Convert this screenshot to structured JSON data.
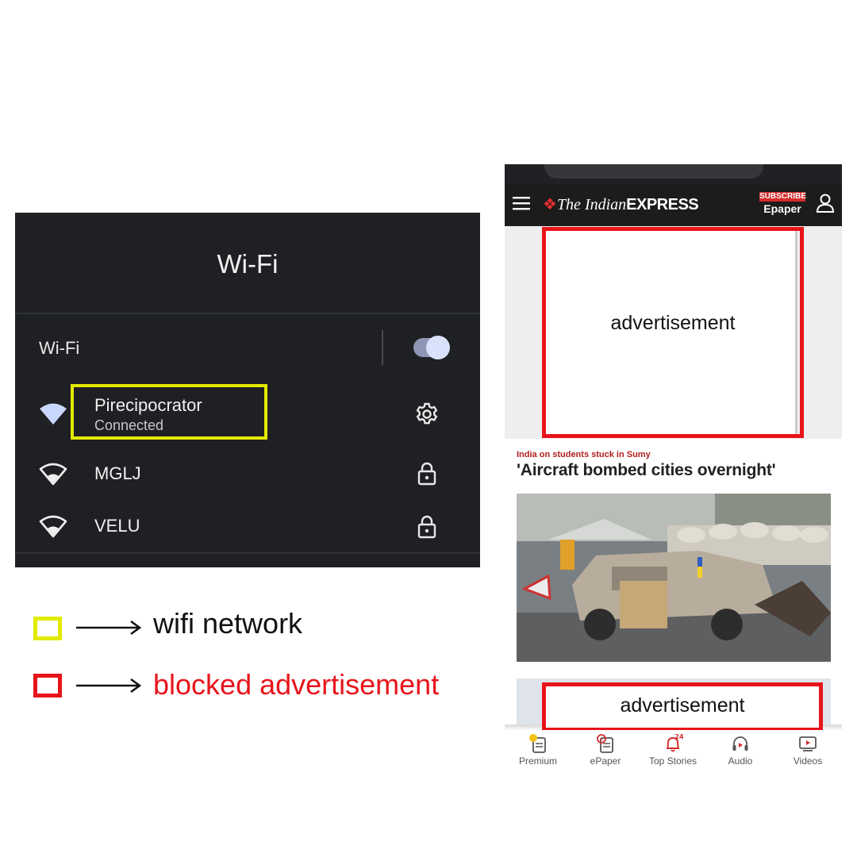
{
  "wifi_panel": {
    "title": "Wi-Fi",
    "toggle_label": "Wi-Fi",
    "toggle_on": true,
    "networks": [
      {
        "name": "Pirecipocrator",
        "status": "Connected",
        "icon": "wifi-full-icon",
        "action_icon": "gear-icon"
      },
      {
        "name": "MGLJ",
        "icon": "wifi-outline-icon",
        "action_icon": "lock-icon"
      },
      {
        "name": "VELU",
        "icon": "wifi-outline-icon",
        "action_icon": "lock-icon"
      }
    ]
  },
  "legend": {
    "items": [
      {
        "label": "wifi network",
        "color": "#e2ea00",
        "text_color": "#111111"
      },
      {
        "label": "blocked advertisement",
        "color": "#e8141b",
        "text_color": "#e8141b"
      }
    ]
  },
  "phone": {
    "site": {
      "logo_the": "The Indian",
      "logo_express": "EXPRESS",
      "subscribe": "SUBSCRIBE",
      "epaper": "Epaper"
    },
    "ad_label_top": "ADVERTISEMENT",
    "ad_top_text": "advertisement",
    "article": {
      "kicker": "India on students stuck in Sumy",
      "headline": "'Aircraft bombed cities overnight'"
    },
    "ad_bottom_text": "advertisement",
    "bottom_nav": [
      {
        "label": "Premium",
        "icon": "premium-icon"
      },
      {
        "label": "ePaper",
        "icon": "epaper-icon"
      },
      {
        "label": "Top Stories",
        "icon": "bell-icon",
        "badge": "24"
      },
      {
        "label": "Audio",
        "icon": "headphones-icon"
      },
      {
        "label": "Videos",
        "icon": "video-icon"
      }
    ],
    "colors": {
      "brand_red": "#e32f2f",
      "header_bg": "#1c1c1c"
    }
  }
}
